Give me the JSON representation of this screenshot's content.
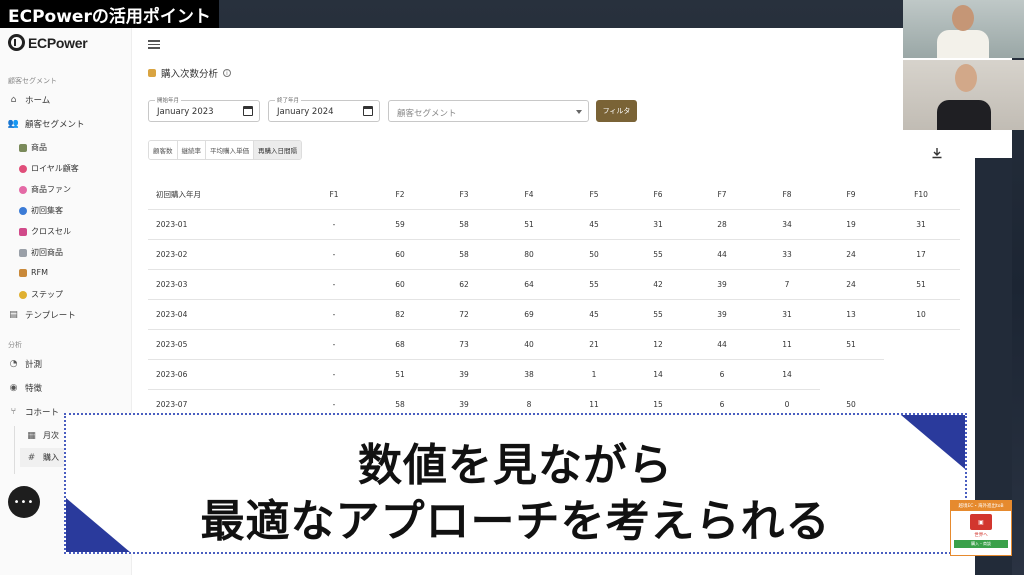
{
  "video_label": "ECPowerの活用ポイント",
  "app": {
    "logo": "ECPower",
    "page_title": "購入次数分析",
    "sidebar": {
      "section_segment": "顧客セグメント",
      "home": "ホーム",
      "segment": "顧客セグメント",
      "sub_items": [
        "商品",
        "ロイヤル顧客",
        "商品ファン",
        "初回集客",
        "クロスセル",
        "初回商品",
        "RFM",
        "ステップ"
      ],
      "template": "テンプレート",
      "section_analysis": "分析",
      "measure": "計測",
      "feature": "特徴",
      "cohort": "コホート",
      "cohort_children": [
        "月次",
        "購入"
      ]
    },
    "filters": {
      "start_label": "開始年月",
      "start_value": "January 2023",
      "end_label": "終了年月",
      "end_value": "January 2024",
      "segment_placeholder": "顧客セグメント",
      "filter_button": "フィルタ"
    },
    "tabs": [
      "顧客数",
      "継続率",
      "平均購入単価",
      "再購入日間隔"
    ],
    "active_tab": 3,
    "table": {
      "headers": [
        "初回購入年月",
        "F1",
        "F2",
        "F3",
        "F4",
        "F5",
        "F6",
        "F7",
        "F8",
        "F9",
        "F10"
      ],
      "rows": [
        [
          "2023-01",
          "-",
          "59",
          "58",
          "51",
          "45",
          "31",
          "28",
          "34",
          "19",
          "31"
        ],
        [
          "2023-02",
          "-",
          "60",
          "58",
          "80",
          "50",
          "55",
          "44",
          "33",
          "24",
          "17"
        ],
        [
          "2023-03",
          "-",
          "60",
          "62",
          "64",
          "55",
          "42",
          "39",
          "7",
          "24",
          "51"
        ],
        [
          "2023-04",
          "-",
          "82",
          "72",
          "69",
          "45",
          "55",
          "39",
          "31",
          "13",
          "10"
        ],
        [
          "2023-05",
          "-",
          "68",
          "73",
          "40",
          "21",
          "12",
          "44",
          "11",
          "51",
          ""
        ],
        [
          "2023-06",
          "-",
          "51",
          "39",
          "38",
          "1",
          "14",
          "6",
          "14",
          "",
          ""
        ],
        [
          "2023-07",
          "-",
          "58",
          "39",
          "8",
          "11",
          "15",
          "6",
          "0",
          "50",
          ""
        ]
      ]
    }
  },
  "caption": {
    "line1": "数値を見ながら",
    "line2": "最適なアプローチを考えられる"
  },
  "badge": {
    "top": "越境EC・海外進出toB",
    "mid": "世界へ",
    "bottom": "購入・商談"
  },
  "colors": {
    "filter_button": "#7a6336",
    "caption_accent": "#2a3a9c",
    "badge_orange": "#e68a2e"
  }
}
